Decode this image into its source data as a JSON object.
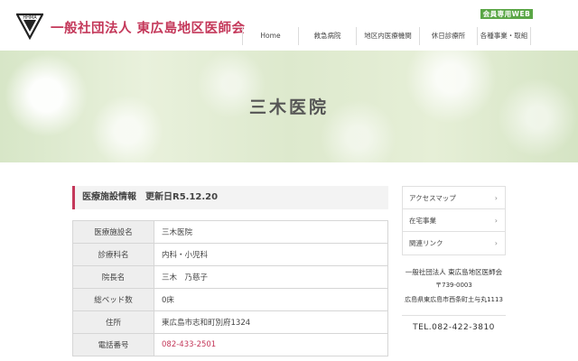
{
  "header": {
    "logo_abbr": "HHMA",
    "site_title": "一般社団法人 東広島地区医師会",
    "members_badge": "会員専用WEB",
    "nav": [
      "Home",
      "救急病院",
      "地区内医療機関",
      "休日診療所",
      "各種事業・取組"
    ]
  },
  "hero": {
    "title": "三木医院"
  },
  "info": {
    "heading": "医療施設情報　更新日R5.12.20",
    "rows": [
      {
        "label": "医療施設名",
        "value": "三木医院"
      },
      {
        "label": "診療科名",
        "value": "内科・小児科"
      },
      {
        "label": "院長名",
        "value": "三木　乃慈子"
      },
      {
        "label": "総ベッド数",
        "value": "0床"
      },
      {
        "label": "住所",
        "value": "東広島市志和町別府1324"
      },
      {
        "label": "電話番号",
        "value": "082-433-2501"
      }
    ]
  },
  "sidebar": {
    "menu": [
      "アクセスマップ",
      "在宅事業",
      "関連リンク"
    ],
    "arrow": "›",
    "org_name": "一般社団法人 東広島地区医師会",
    "zip": "〒739-0003",
    "address": "広島県東広島市西条町土与丸1113",
    "tel": "TEL.082-422-3810"
  },
  "colors": {
    "accent": "#c4385a",
    "members_badge": "#5aa646",
    "hero_bg": "#e2edd4"
  }
}
